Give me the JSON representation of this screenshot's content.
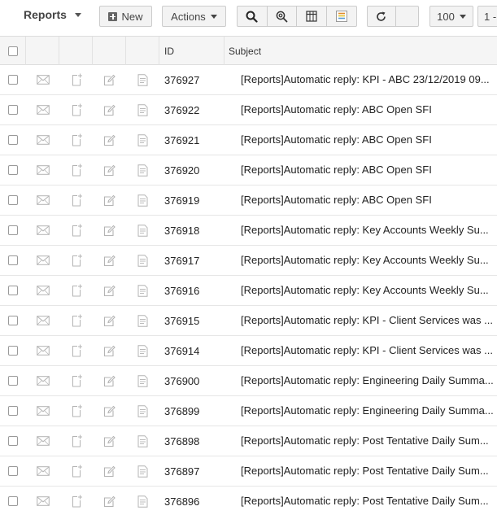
{
  "toolbar": {
    "title": "Reports",
    "new_label": "New",
    "actions_label": "Actions",
    "page_size": "100",
    "range_label": "1 -"
  },
  "table": {
    "columns": {
      "id": "ID",
      "subject": "Subject"
    },
    "rows": [
      {
        "id": "376927",
        "subject": "[Reports]Automatic reply: KPI - ABC 23/12/2019 09..."
      },
      {
        "id": "376922",
        "subject": "[Reports]Automatic reply: ABC Open SFI"
      },
      {
        "id": "376921",
        "subject": "[Reports]Automatic reply: ABC Open SFI"
      },
      {
        "id": "376920",
        "subject": "[Reports]Automatic reply: ABC Open SFI"
      },
      {
        "id": "376919",
        "subject": "[Reports]Automatic reply: ABC Open SFI"
      },
      {
        "id": "376918",
        "subject": "[Reports]Automatic reply: Key Accounts Weekly Su..."
      },
      {
        "id": "376917",
        "subject": "[Reports]Automatic reply: Key Accounts Weekly Su..."
      },
      {
        "id": "376916",
        "subject": "[Reports]Automatic reply: Key Accounts Weekly Su..."
      },
      {
        "id": "376915",
        "subject": "[Reports]Automatic reply: KPI - Client Services was ..."
      },
      {
        "id": "376914",
        "subject": "[Reports]Automatic reply: KPI - Client Services was ..."
      },
      {
        "id": "376900",
        "subject": "[Reports]Automatic reply: Engineering Daily Summa..."
      },
      {
        "id": "376899",
        "subject": "[Reports]Automatic reply: Engineering Daily Summa..."
      },
      {
        "id": "376898",
        "subject": "[Reports]Automatic reply: Post Tentative Daily Sum..."
      },
      {
        "id": "376897",
        "subject": "[Reports]Automatic reply: Post Tentative Daily Sum..."
      },
      {
        "id": "376896",
        "subject": "[Reports]Automatic reply: Post Tentative Daily Sum..."
      }
    ]
  },
  "icons": {
    "title_caret": "caret-down-icon",
    "new": "plus-square-icon",
    "search": "search-icon",
    "advanced_search": "magnify-filter-icon",
    "columns": "grid-columns-icon",
    "notes_view": "notes-view-icon",
    "refresh": "refresh-icon",
    "row_mail": "envelope-icon",
    "row_new_doc": "new-document-icon",
    "row_edit": "edit-icon",
    "row_report": "report-icon"
  }
}
